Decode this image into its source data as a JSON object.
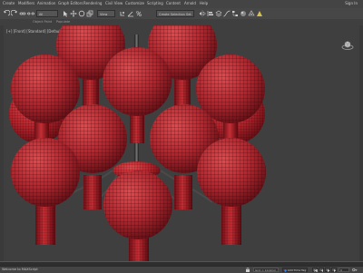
{
  "menubar": {
    "items": [
      "Create",
      "Modifiers",
      "Animation",
      "Graph Editors",
      "Rendering",
      "Civil View",
      "Customize",
      "Scripting",
      "Content",
      "Arnold",
      "Help"
    ],
    "sign_in": "Sign In"
  },
  "toolbar": {
    "selection_set_placeholder": "Create Selection Set",
    "view_dropdown": "View"
  },
  "ribbon": {
    "tabs": [
      "Object Paint",
      "Populate"
    ]
  },
  "viewport": {
    "label": "[+] [Front] [Standard] [Default Shading]",
    "object_color": "#b3232b"
  },
  "status": {
    "left_text": "Welcome to MAXScript",
    "add_time_tag": "Add Time Tag",
    "grid": "Grid = 10.0mm",
    "frame": "0"
  },
  "icons": [
    "undo-icon",
    "redo-icon",
    "link-icon",
    "unlink-icon",
    "select-icon",
    "move-icon",
    "rotate-icon",
    "scale-icon",
    "snap-icon",
    "mirror-icon",
    "align-icon",
    "render-icon",
    "play-icon",
    "key-icon",
    "viewcube-icon"
  ]
}
